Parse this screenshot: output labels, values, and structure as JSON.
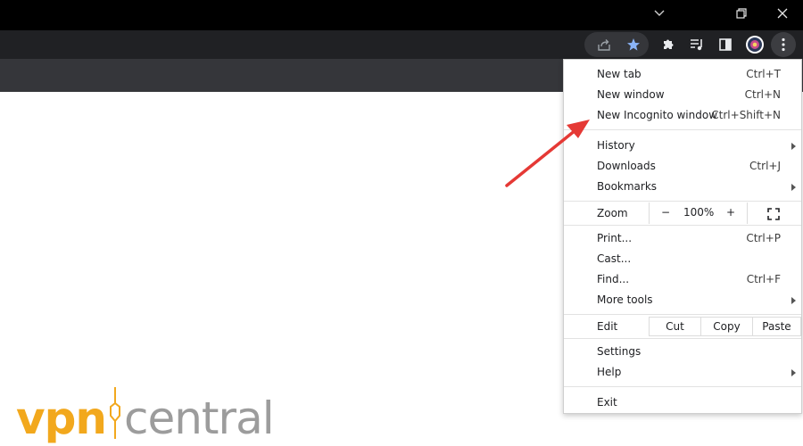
{
  "menu": {
    "new_tab": {
      "label": "New tab",
      "shortcut": "Ctrl+T"
    },
    "new_window": {
      "label": "New window",
      "shortcut": "Ctrl+N"
    },
    "new_incognito": {
      "label": "New Incognito window",
      "shortcut": "Ctrl+Shift+N"
    },
    "history": {
      "label": "History"
    },
    "downloads": {
      "label": "Downloads",
      "shortcut": "Ctrl+J"
    },
    "bookmarks": {
      "label": "Bookmarks"
    },
    "zoom": {
      "label": "Zoom",
      "minus": "−",
      "value": "100%",
      "plus": "+"
    },
    "print": {
      "label": "Print...",
      "shortcut": "Ctrl+P"
    },
    "cast": {
      "label": "Cast..."
    },
    "find": {
      "label": "Find...",
      "shortcut": "Ctrl+F"
    },
    "more_tools": {
      "label": "More tools"
    },
    "edit": {
      "label": "Edit",
      "cut": "Cut",
      "copy": "Copy",
      "paste": "Paste"
    },
    "settings": {
      "label": "Settings"
    },
    "help": {
      "label": "Help"
    },
    "exit": {
      "label": "Exit"
    }
  },
  "logo": {
    "part1": "vpn",
    "part2": "central"
  },
  "colors": {
    "titlebar": "#000000",
    "toolbar": "#202124",
    "bookmark_bar": "#35363a",
    "star": "#8ab4f8",
    "annotation_arrow": "#e53935",
    "logo_orange": "#f2a81d",
    "logo_gray": "#9c9c9c"
  },
  "icons": [
    "chevron-down-icon",
    "restore-icon",
    "close-icon",
    "share-icon",
    "star-icon",
    "puzzle-icon",
    "media-queue-icon",
    "side-panel-icon",
    "profile-avatar-icon",
    "kebab-menu-icon",
    "fullscreen-icon"
  ]
}
